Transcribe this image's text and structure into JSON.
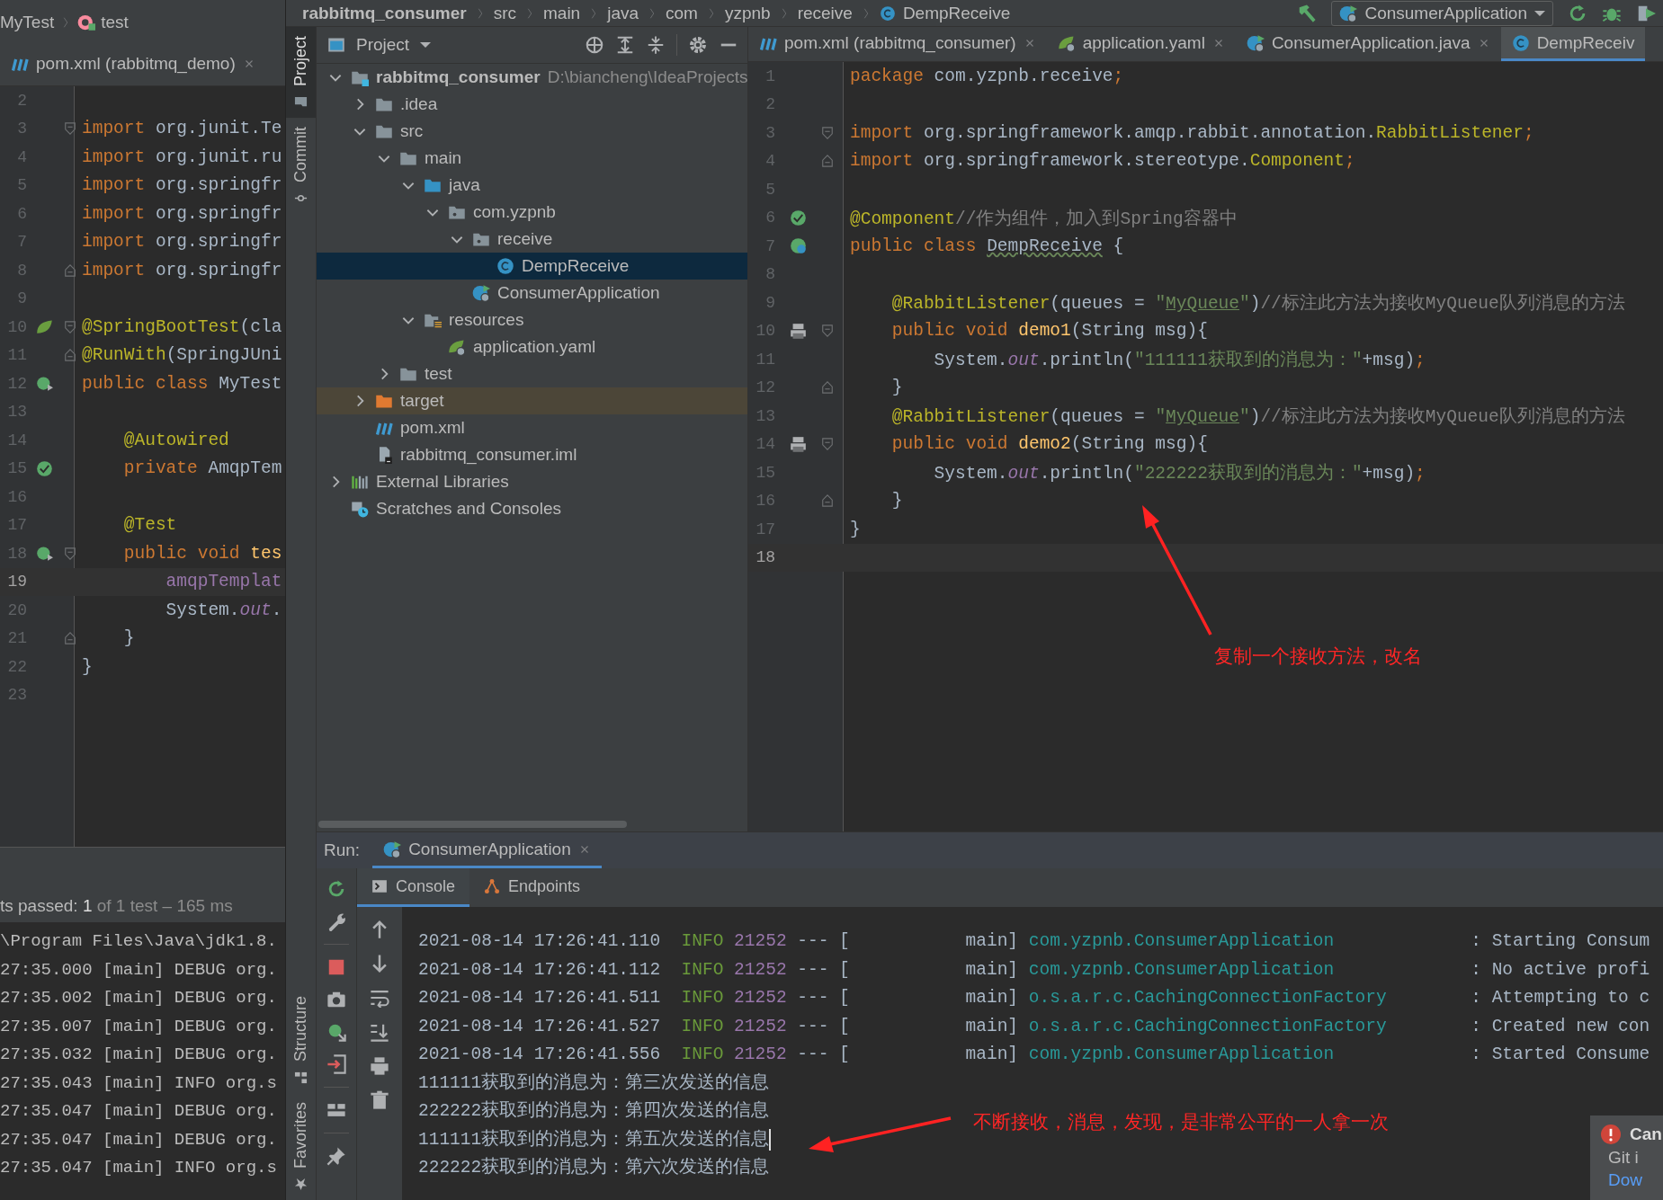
{
  "left_panel": {
    "breadcrumb": [
      {
        "label": "MyTest",
        "kind": "plain"
      },
      {
        "label": "test",
        "kind": "method"
      }
    ],
    "tab": {
      "label": "pom.xml (rabbitmq_demo)",
      "kind": "xml"
    },
    "code_lines": [
      {
        "number": "2"
      },
      {
        "number": "3",
        "tokens": [
          {
            "kind": "keyword",
            "text": "import"
          },
          {
            "kind": "plain",
            "text": " org.junit.Te"
          }
        ],
        "fold": {
          "kind": "start"
        }
      },
      {
        "number": "4",
        "tokens": [
          {
            "kind": "keyword",
            "text": "import"
          },
          {
            "kind": "plain",
            "text": " org.junit.ru"
          }
        ]
      },
      {
        "number": "5",
        "tokens": [
          {
            "kind": "keyword",
            "text": "import"
          },
          {
            "kind": "plain",
            "text": " org.springfr"
          }
        ]
      },
      {
        "number": "6",
        "tokens": [
          {
            "kind": "keyword",
            "text": "import"
          },
          {
            "kind": "plain",
            "text": " org.springfr"
          }
        ]
      },
      {
        "number": "7",
        "tokens": [
          {
            "kind": "keyword",
            "text": "import"
          },
          {
            "kind": "plain",
            "text": " org.springfr"
          }
        ]
      },
      {
        "number": "8",
        "tokens": [
          {
            "kind": "keyword",
            "text": "import"
          },
          {
            "kind": "plain",
            "text": " org.springfr"
          }
        ],
        "fold": {
          "kind": "end"
        }
      },
      {
        "number": "9"
      },
      {
        "number": "10",
        "tokens": [
          {
            "kind": "annotation",
            "text": "@SpringBootTest"
          },
          {
            "kind": "plain",
            "text": "(cla"
          }
        ],
        "gutter": {
          "kind": "spring"
        },
        "fold": {
          "kind": "start"
        }
      },
      {
        "number": "11",
        "tokens": [
          {
            "kind": "annotation",
            "text": "@RunWith"
          },
          {
            "kind": "plain",
            "text": "(SpringJUni"
          }
        ],
        "fold": {
          "kind": "end"
        }
      },
      {
        "number": "12",
        "tokens": [
          {
            "kind": "keyword",
            "text": "public class "
          },
          {
            "kind": "plain",
            "text": "MyTest"
          }
        ],
        "gutter": {
          "kind": "run"
        }
      },
      {
        "number": "13"
      },
      {
        "number": "14",
        "tokens": [
          {
            "kind": "annotation",
            "text": "    @Autowired"
          }
        ]
      },
      {
        "number": "15",
        "tokens": [
          {
            "kind": "keyword",
            "text": "    private "
          },
          {
            "kind": "plain",
            "text": "AmqpTem"
          }
        ],
        "gutter": {
          "kind": "bean"
        }
      },
      {
        "number": "16"
      },
      {
        "number": "17",
        "tokens": [
          {
            "kind": "annotation",
            "text": "    @Test"
          }
        ]
      },
      {
        "number": "18",
        "tokens": [
          {
            "kind": "keyword",
            "text": "    public void "
          },
          {
            "kind": "method",
            "text": "tes"
          }
        ],
        "gutter": {
          "kind": "run"
        },
        "fold": {
          "kind": "start"
        }
      },
      {
        "number": "19",
        "tokens": [
          {
            "kind": "field",
            "text": "        amqpTemplat"
          }
        ],
        "current": true
      },
      {
        "number": "20",
        "tokens": [
          {
            "kind": "plain",
            "text": "        System."
          },
          {
            "kind": "static",
            "text": "out"
          },
          {
            "kind": "plain",
            "text": "."
          }
        ]
      },
      {
        "number": "21",
        "tokens": [
          {
            "kind": "plain",
            "text": "    }"
          }
        ],
        "fold": {
          "kind": "end"
        }
      },
      {
        "number": "22",
        "tokens": [
          {
            "kind": "plain",
            "text": "}"
          }
        ]
      },
      {
        "number": "23"
      }
    ],
    "test_status": {
      "label": "ts passed:",
      "count": "1",
      "detail": "of 1 test – 165 ms"
    },
    "console_lines": [
      "\\Program Files\\Java\\jdk1.8.",
      "27:35.000 [main] DEBUG org.",
      "27:35.002 [main] DEBUG org.",
      "27:35.007 [main] DEBUG org.",
      "27:35.032 [main] DEBUG org.",
      "27:35.043 [main] INFO org.s",
      "27:35.047 [main] DEBUG org.",
      "27:35.047 [main] DEBUG org.",
      "27:35.047 [main] INFO org.s"
    ]
  },
  "breadcrumb": [
    {
      "label": "rabbitmq_consumer",
      "kind": "project"
    },
    {
      "label": "src",
      "kind": "folder"
    },
    {
      "label": "main",
      "kind": "folder"
    },
    {
      "label": "java",
      "kind": "folder"
    },
    {
      "label": "com",
      "kind": "folder"
    },
    {
      "label": "yzpnb",
      "kind": "folder"
    },
    {
      "label": "receive",
      "kind": "folder"
    },
    {
      "label": "DempReceive",
      "kind": "class"
    }
  ],
  "run_configuration": {
    "label": "ConsumerApplication"
  },
  "tool_strip": {
    "top": [
      {
        "label": "Project",
        "selected": true
      },
      {
        "label": "Commit",
        "selected": false
      }
    ],
    "bottom": [
      {
        "label": "Structure",
        "selected": false
      },
      {
        "label": "Favorites",
        "selected": false
      }
    ]
  },
  "project_panel": {
    "title": "Project",
    "tree": [
      {
        "label": "rabbitmq_consumer",
        "path": "D:\\biancheng\\IdeaProjects",
        "kind": "module",
        "expanded": true,
        "selected": false,
        "children": [
          {
            "label": ".idea",
            "kind": "folder",
            "expanded": false,
            "selected": false
          },
          {
            "label": "src",
            "kind": "folder",
            "expanded": true,
            "selected": false,
            "children": [
              {
                "label": "main",
                "kind": "folder",
                "expanded": true,
                "selected": false,
                "children": [
                  {
                    "label": "java",
                    "kind": "source_folder",
                    "expanded": true,
                    "selected": false,
                    "children": [
                      {
                        "label": "com.yzpnb",
                        "kind": "package",
                        "expanded": true,
                        "selected": false,
                        "children": [
                          {
                            "label": "receive",
                            "kind": "package",
                            "expanded": true,
                            "selected": false,
                            "children": [
                              {
                                "label": "DempReceive",
                                "kind": "class",
                                "selected": true
                              }
                            ]
                          },
                          {
                            "label": "ConsumerApplication",
                            "kind": "spring_class",
                            "selected": false
                          }
                        ]
                      }
                    ]
                  },
                  {
                    "label": "resources",
                    "kind": "resource_folder",
                    "expanded": true,
                    "selected": false,
                    "children": [
                      {
                        "label": "application.yaml",
                        "kind": "yaml",
                        "selected": false
                      }
                    ]
                  }
                ]
              },
              {
                "label": "test",
                "kind": "folder",
                "expanded": false,
                "selected": false
              }
            ]
          },
          {
            "label": "target",
            "kind": "excluded_folder",
            "expanded": false,
            "selected": false
          },
          {
            "label": "pom.xml",
            "kind": "xml",
            "selected": false
          },
          {
            "label": "rabbitmq_consumer.iml",
            "kind": "iml",
            "selected": false
          }
        ]
      },
      {
        "label": "External Libraries",
        "kind": "libraries",
        "expanded": false,
        "selected": false
      },
      {
        "label": "Scratches and Consoles",
        "kind": "scratches",
        "selected": false
      }
    ]
  },
  "editor": {
    "tabs": [
      {
        "label": "pom.xml (rabbitmq_consumer)",
        "kind": "xml",
        "selected": false,
        "closable": true
      },
      {
        "label": "application.yaml",
        "kind": "yaml",
        "selected": false,
        "closable": true
      },
      {
        "label": "ConsumerApplication.java",
        "kind": "spring_class",
        "selected": false,
        "closable": true
      },
      {
        "label": "DempReceiv",
        "kind": "class",
        "selected": true,
        "closable": false
      }
    ],
    "lines": [
      {
        "number": "1",
        "tokens": [
          {
            "kind": "keyword",
            "text": "package"
          },
          {
            "kind": "plain",
            "text": " com.yzpnb.receive"
          },
          {
            "kind": "keyword",
            "text": ";"
          }
        ]
      },
      {
        "number": "2"
      },
      {
        "number": "3",
        "tokens": [
          {
            "kind": "keyword",
            "text": "import"
          },
          {
            "kind": "plain",
            "text": " org.springframework.amqp.rabbit.annotation."
          },
          {
            "kind": "type",
            "text": "RabbitListener"
          },
          {
            "kind": "keyword",
            "text": ";"
          }
        ],
        "fold": {
          "kind": "start"
        }
      },
      {
        "number": "4",
        "tokens": [
          {
            "kind": "keyword",
            "text": "import"
          },
          {
            "kind": "plain",
            "text": " org.springframework.stereotype."
          },
          {
            "kind": "type",
            "text": "Component"
          },
          {
            "kind": "keyword",
            "text": ";"
          }
        ],
        "fold": {
          "kind": "end"
        }
      },
      {
        "number": "5"
      },
      {
        "number": "6",
        "tokens": [
          {
            "kind": "annotation",
            "text": "@Component"
          },
          {
            "kind": "comment",
            "text": "//作为组件，加入到Spring容器中"
          }
        ],
        "gutter": {
          "kind": "bean"
        }
      },
      {
        "number": "7",
        "tokens": [
          {
            "kind": "keyword",
            "text": "public class "
          },
          {
            "kind": "typo",
            "text": "DempReceive"
          },
          {
            "kind": "plain",
            "text": " {"
          }
        ],
        "gutter": {
          "kind": "bean_class"
        }
      },
      {
        "number": "8"
      },
      {
        "number": "9",
        "tokens": [
          {
            "kind": "annotation",
            "text": "    @RabbitListener"
          },
          {
            "kind": "plain",
            "text": "(queues = "
          },
          {
            "kind": "string",
            "text": "\""
          },
          {
            "kind": "link",
            "text": "MyQueue"
          },
          {
            "kind": "string",
            "text": "\""
          },
          {
            "kind": "plain",
            "text": ")"
          },
          {
            "kind": "comment",
            "text": "//标注此方法为接收MyQueue队列消息的方法"
          }
        ]
      },
      {
        "number": "10",
        "tokens": [
          {
            "kind": "keyword",
            "text": "    public void "
          },
          {
            "kind": "method",
            "text": "demo1"
          },
          {
            "kind": "plain",
            "text": "(String msg){"
          }
        ],
        "gutter": {
          "kind": "listener"
        },
        "fold": {
          "kind": "start"
        }
      },
      {
        "number": "11",
        "tokens": [
          {
            "kind": "plain",
            "text": "        System."
          },
          {
            "kind": "static",
            "text": "out"
          },
          {
            "kind": "plain",
            "text": ".println("
          },
          {
            "kind": "string",
            "text": "\"111111获取到的消息为：\""
          },
          {
            "kind": "plain",
            "text": "+msg)"
          },
          {
            "kind": "keyword",
            "text": ";"
          }
        ]
      },
      {
        "number": "12",
        "tokens": [
          {
            "kind": "plain",
            "text": "    }"
          }
        ],
        "fold": {
          "kind": "end"
        }
      },
      {
        "number": "13",
        "tokens": [
          {
            "kind": "annotation",
            "text": "    @RabbitListener"
          },
          {
            "kind": "plain",
            "text": "(queues = "
          },
          {
            "kind": "string",
            "text": "\""
          },
          {
            "kind": "link",
            "text": "MyQueue"
          },
          {
            "kind": "string",
            "text": "\""
          },
          {
            "kind": "plain",
            "text": ")"
          },
          {
            "kind": "comment",
            "text": "//标注此方法为接收MyQueue队列消息的方法"
          }
        ]
      },
      {
        "number": "14",
        "tokens": [
          {
            "kind": "keyword",
            "text": "    public void "
          },
          {
            "kind": "method",
            "text": "demo2"
          },
          {
            "kind": "plain",
            "text": "(String msg){"
          }
        ],
        "gutter": {
          "kind": "listener"
        },
        "fold": {
          "kind": "start"
        }
      },
      {
        "number": "15",
        "tokens": [
          {
            "kind": "plain",
            "text": "        System."
          },
          {
            "kind": "static",
            "text": "out"
          },
          {
            "kind": "plain",
            "text": ".println("
          },
          {
            "kind": "string",
            "text": "\"222222获取到的消息为：\""
          },
          {
            "kind": "plain",
            "text": "+msg)"
          },
          {
            "kind": "keyword",
            "text": ";"
          }
        ]
      },
      {
        "number": "16",
        "tokens": [
          {
            "kind": "plain",
            "text": "    }"
          }
        ],
        "fold": {
          "kind": "end"
        }
      },
      {
        "number": "17",
        "tokens": [
          {
            "kind": "plain",
            "text": "}"
          }
        ]
      },
      {
        "number": "18",
        "current": true
      }
    ]
  },
  "run_panel": {
    "title": "Run:",
    "tab": {
      "label": "ConsumerApplication",
      "selected": true
    },
    "subtabs": [
      {
        "label": "Console",
        "kind": "console",
        "selected": true
      },
      {
        "label": "Endpoints",
        "kind": "endpoints",
        "selected": false
      }
    ],
    "console_lines": [
      {
        "tokens": [
          {
            "kind": "plain",
            "text": "2021-08-14 17:26:41.110  "
          },
          {
            "kind": "level",
            "text": "INFO"
          },
          {
            "kind": "pid",
            "text": " 21252"
          },
          {
            "kind": "plain",
            "text": " --- [           main] "
          },
          {
            "kind": "logger",
            "text": "com.yzpnb.ConsumerApplication"
          },
          {
            "kind": "plain",
            "text": "             : Starting Consum"
          }
        ],
        "cursor": false
      },
      {
        "tokens": [
          {
            "kind": "plain",
            "text": "2021-08-14 17:26:41.112  "
          },
          {
            "kind": "level",
            "text": "INFO"
          },
          {
            "kind": "pid",
            "text": " 21252"
          },
          {
            "kind": "plain",
            "text": " --- [           main] "
          },
          {
            "kind": "logger",
            "text": "com.yzpnb.ConsumerApplication"
          },
          {
            "kind": "plain",
            "text": "             : No active profi"
          }
        ],
        "cursor": false
      },
      {
        "tokens": [
          {
            "kind": "plain",
            "text": "2021-08-14 17:26:41.511  "
          },
          {
            "kind": "level",
            "text": "INFO"
          },
          {
            "kind": "pid",
            "text": " 21252"
          },
          {
            "kind": "plain",
            "text": " --- [           main] "
          },
          {
            "kind": "logger",
            "text": "o.s.a.r.c.CachingConnectionFactory"
          },
          {
            "kind": "plain",
            "text": "        : Attempting to c"
          }
        ],
        "cursor": false
      },
      {
        "tokens": [
          {
            "kind": "plain",
            "text": "2021-08-14 17:26:41.527  "
          },
          {
            "kind": "level",
            "text": "INFO"
          },
          {
            "kind": "pid",
            "text": " 21252"
          },
          {
            "kind": "plain",
            "text": " --- [           main] "
          },
          {
            "kind": "logger",
            "text": "o.s.a.r.c.CachingConnectionFactory"
          },
          {
            "kind": "plain",
            "text": "        : Created new con"
          }
        ],
        "cursor": false
      },
      {
        "tokens": [
          {
            "kind": "plain",
            "text": "2021-08-14 17:26:41.556  "
          },
          {
            "kind": "level",
            "text": "INFO"
          },
          {
            "kind": "pid",
            "text": " 21252"
          },
          {
            "kind": "plain",
            "text": " --- [           main] "
          },
          {
            "kind": "logger",
            "text": "com.yzpnb.ConsumerApplication"
          },
          {
            "kind": "plain",
            "text": "             : Started Consume"
          }
        ],
        "cursor": false
      },
      {
        "tokens": [
          {
            "kind": "plain",
            "text": "111111获取到的消息为：第三次发送的信息"
          }
        ],
        "cursor": false
      },
      {
        "tokens": [
          {
            "kind": "plain",
            "text": "222222获取到的消息为：第四次发送的信息"
          }
        ],
        "cursor": false
      },
      {
        "tokens": [
          {
            "kind": "plain",
            "text": "111111获取到的消息为：第五次发送的信息"
          }
        ],
        "cursor": true
      },
      {
        "tokens": [
          {
            "kind": "plain",
            "text": "222222获取到的消息为：第六次发送的信息"
          }
        ],
        "cursor": false
      }
    ]
  },
  "annotations": [
    {
      "text": "复制一个接收方法，改名"
    },
    {
      "text": "不断接收，消息，发现，是非常公平的一人拿一次"
    }
  ],
  "notification": {
    "title": "Can",
    "body": "Git i",
    "link": "Dow"
  }
}
